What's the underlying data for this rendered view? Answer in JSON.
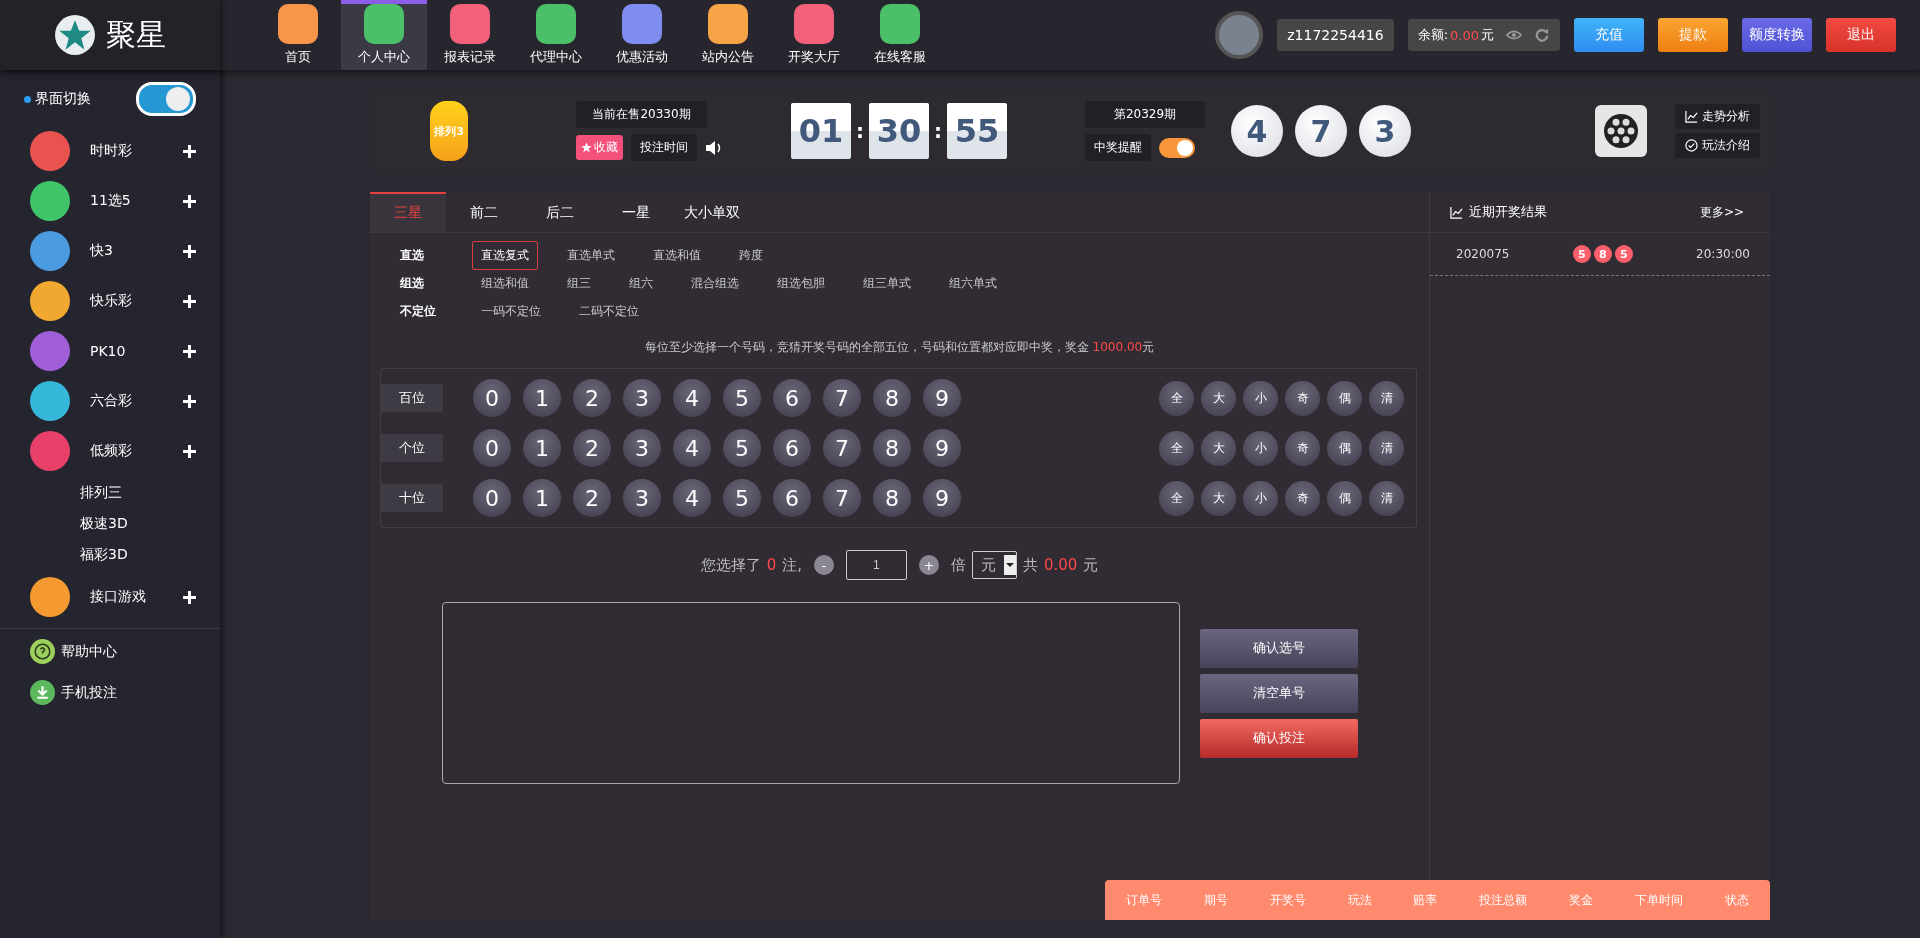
{
  "brand": {
    "name": "聚星"
  },
  "nav": [
    {
      "label": "首页",
      "selected": false,
      "color": "#f7964a"
    },
    {
      "label": "个人中心",
      "selected": true,
      "color": "#4cbf6a"
    },
    {
      "label": "报表记录",
      "selected": false,
      "color": "#f2607a"
    },
    {
      "label": "代理中心",
      "selected": false,
      "color": "#4cbf6a"
    },
    {
      "label": "优惠活动",
      "selected": false,
      "color": "#7f8cf0"
    },
    {
      "label": "站内公告",
      "selected": false,
      "color": "#f7a448"
    },
    {
      "label": "开奖大厅",
      "selected": false,
      "color": "#f2607a"
    },
    {
      "label": "在线客服",
      "selected": false,
      "color": "#4cbf6a"
    }
  ],
  "user": {
    "username": "z1172254416",
    "balance_label": "余额:",
    "balance": "0.00",
    "currency": "元"
  },
  "account_buttons": [
    {
      "label": "充值",
      "kind": "blue"
    },
    {
      "label": "提款",
      "kind": "orange"
    },
    {
      "label": "额度转换",
      "kind": "purple"
    },
    {
      "label": "退出",
      "kind": "red"
    }
  ],
  "sidebar": {
    "switch_label": "界面切换",
    "switch_on": true,
    "categories": [
      {
        "name": "时时彩",
        "color": "#e8524f"
      },
      {
        "name": "11选5",
        "color": "#3fc46a"
      },
      {
        "name": "快3",
        "color": "#4a9be0"
      },
      {
        "name": "快乐彩",
        "color": "#f0a830"
      },
      {
        "name": "PK10",
        "color": "#a05ed8"
      },
      {
        "name": "六合彩",
        "color": "#34b7d8"
      },
      {
        "name": "低频彩",
        "color": "#e9406a",
        "children": [
          {
            "name": "排列三"
          },
          {
            "name": "极速3D"
          },
          {
            "name": "福彩3D"
          }
        ]
      },
      {
        "name": "接口游戏",
        "color": "#f59a30"
      }
    ],
    "footer_links": [
      {
        "label": "帮助中心",
        "kind": "help"
      },
      {
        "label": "手机投注",
        "kind": "download"
      }
    ]
  },
  "game": {
    "logo_text": "排列3",
    "current_issue": "当前在售20330期",
    "favorite": "收藏",
    "bet_time": "投注时间",
    "countdown": [
      "01",
      "30",
      "55"
    ],
    "countdown_separator": ":",
    "last_issue": "第20329期",
    "win_alert_label": "中奖提醒",
    "win_alert_on": true,
    "result_balls": [
      "4",
      "7",
      "3"
    ],
    "links": [
      {
        "label": "走势分析",
        "kind": "chart"
      },
      {
        "label": "玩法介绍",
        "kind": "check"
      }
    ]
  },
  "tabs": [
    {
      "label": "三星",
      "selected": true
    },
    {
      "label": "前二",
      "selected": false
    },
    {
      "label": "后二",
      "selected": false
    },
    {
      "label": "一星",
      "selected": false
    },
    {
      "label": "大小单双",
      "selected": false
    }
  ],
  "play_groups": [
    {
      "label": "直选",
      "options": [
        {
          "label": "直选复式",
          "selected": true
        },
        {
          "label": "直选单式",
          "selected": false
        },
        {
          "label": "直选和值",
          "selected": false
        },
        {
          "label": "跨度",
          "selected": false
        }
      ]
    },
    {
      "label": "组选",
      "options": [
        {
          "label": "组选和值",
          "selected": false
        },
        {
          "label": "组三",
          "selected": false
        },
        {
          "label": "组六",
          "selected": false
        },
        {
          "label": "混合组选",
          "selected": false
        },
        {
          "label": "组选包胆",
          "selected": false
        },
        {
          "label": "组三单式",
          "selected": false
        },
        {
          "label": "组六单式",
          "selected": false
        }
      ]
    },
    {
      "label": "不定位",
      "options": [
        {
          "label": "一码不定位",
          "selected": false
        },
        {
          "label": "二码不定位",
          "selected": false
        }
      ]
    }
  ],
  "hint": {
    "text": "每位至少选择一个号码，竞猜开奖号码的全部五位，号码和位置都对应即中奖，奖金 ",
    "prize": "1000.00",
    "unit": "元"
  },
  "number_rows": [
    {
      "position": "百位",
      "digits": [
        "0",
        "1",
        "2",
        "3",
        "4",
        "5",
        "6",
        "7",
        "8",
        "9"
      ],
      "quick": [
        "全",
        "大",
        "小",
        "奇",
        "偶",
        "清"
      ]
    },
    {
      "position": "个位",
      "digits": [
        "0",
        "1",
        "2",
        "3",
        "4",
        "5",
        "6",
        "7",
        "8",
        "9"
      ],
      "quick": [
        "全",
        "大",
        "小",
        "奇",
        "偶",
        "清"
      ]
    },
    {
      "position": "十位",
      "digits": [
        "0",
        "1",
        "2",
        "3",
        "4",
        "5",
        "6",
        "7",
        "8",
        "9"
      ],
      "quick": [
        "全",
        "大",
        "小",
        "奇",
        "偶",
        "清"
      ]
    }
  ],
  "bet_summary": {
    "prefix": "您选择了",
    "count": "0",
    "count_suffix": "注,",
    "minus": "-",
    "multiplier": "1",
    "plus": "+",
    "multiplier_label": "倍",
    "unit": "元",
    "total_prefix": "共",
    "total": "0.00",
    "total_unit": "元"
  },
  "action_buttons": [
    {
      "label": "确认选号",
      "kind": "normal"
    },
    {
      "label": "清空单号",
      "kind": "normal"
    },
    {
      "label": "确认投注",
      "kind": "primary"
    }
  ],
  "recent_results": {
    "title": "近期开奖结果",
    "more": "更多>>",
    "rows": [
      {
        "issue": "2020075",
        "balls": [
          "5",
          "8",
          "5"
        ],
        "time": "20:30:00"
      }
    ]
  },
  "orders": {
    "columns": [
      "订单号",
      "期号",
      "开奖号",
      "玩法",
      "赔率",
      "投注总额",
      "奖金",
      "下单时间",
      "状态"
    ]
  }
}
